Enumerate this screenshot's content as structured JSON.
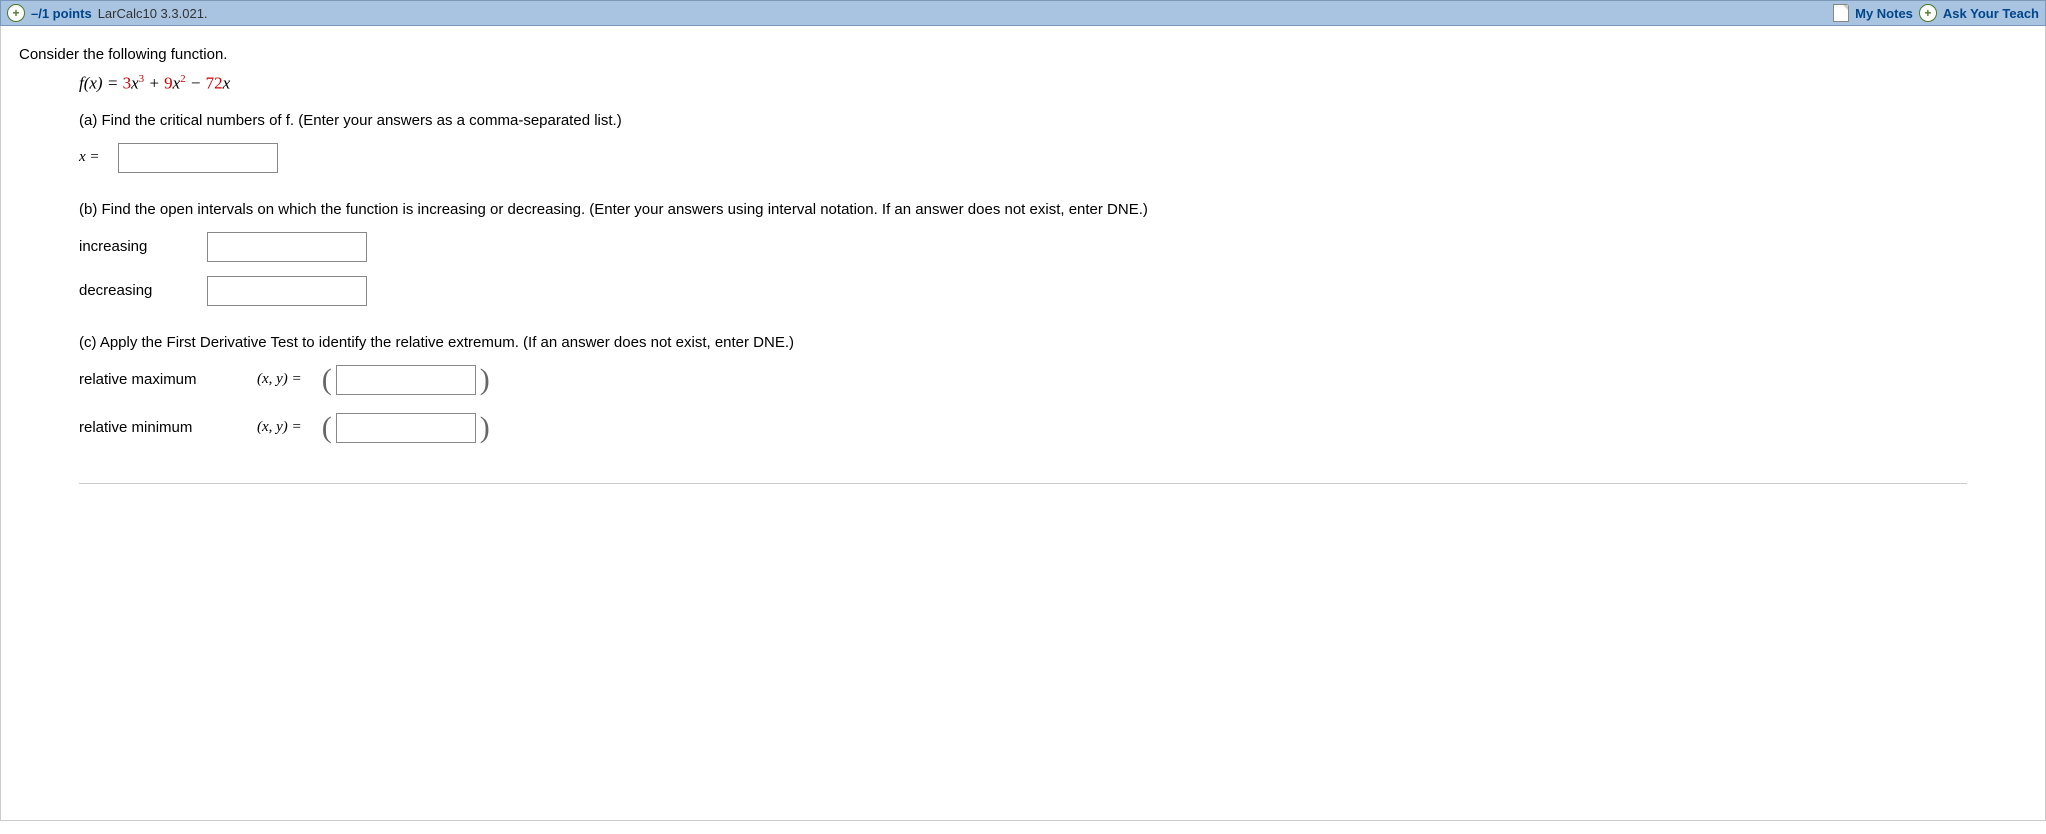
{
  "header": {
    "points": "–/1 points",
    "source": "LarCalc10 3.3.021.",
    "my_notes": "My Notes",
    "ask": "Ask Your Teach"
  },
  "question": {
    "intro": "Consider the following function.",
    "func_lhs": "f(x) = ",
    "term1_coef": "3",
    "term1_var": "x",
    "term1_exp": "3",
    "plus": " + ",
    "term2_coef": "9",
    "term2_var": "x",
    "term2_exp": "2",
    "minus": " − ",
    "term3_coef": "72",
    "term3_var": "x",
    "parts": {
      "a": {
        "text": "(a) Find the critical numbers of f. (Enter your answers as a comma-separated list.)",
        "label": "x ="
      },
      "b": {
        "text": "(b) Find the open intervals on which the function is increasing or decreasing. (Enter your answers using interval notation. If an answer does not exist, enter DNE.)",
        "inc_label": "increasing",
        "dec_label": "decreasing"
      },
      "c": {
        "text": "(c) Apply the First Derivative Test to identify the relative extremum. (If an answer does not exist, enter DNE.)",
        "max_label": "relative maximum",
        "min_label": "relative minimum",
        "xy": "(x, y)  ="
      }
    }
  }
}
